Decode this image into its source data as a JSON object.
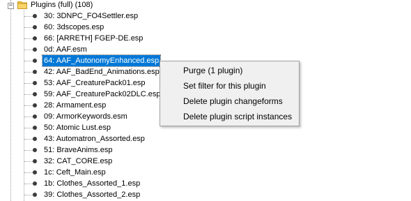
{
  "tree": {
    "root_label": "Plugins (full) (108)",
    "root_expander": "−",
    "items": [
      {
        "label": "30: 3DNPC_FO4Settler.esp"
      },
      {
        "label": "60: 3dscopes.esp"
      },
      {
        "label": "66: [ARRETH] FGEP-DE.esp"
      },
      {
        "label": "0d: AAF.esm"
      },
      {
        "label": "64: AAF_AutonomyEnhanced.esp"
      },
      {
        "label": "42: AAF_BadEnd_Animations.esp"
      },
      {
        "label": "53: AAF_CreaturePack01.esp"
      },
      {
        "label": "59: AAF_CreaturePack02DLC.esp"
      },
      {
        "label": "28: Armament.esp"
      },
      {
        "label": "09: ArmorKeywords.esm"
      },
      {
        "label": "50: Atomic Lust.esp"
      },
      {
        "label": "43: Automatron_Assorted.esp"
      },
      {
        "label": "51: BraveAnims.esp"
      },
      {
        "label": "32: CAT_CORE.esp"
      },
      {
        "label": "1c: Ceft_Main.esp"
      },
      {
        "label": "1b: Clothes_Assorted_1.esp"
      },
      {
        "label": "39: Clothes_Assorted_2.esp"
      }
    ]
  },
  "context_menu": {
    "items": [
      {
        "label": "Purge (1 plugin)"
      },
      {
        "label": "Set filter for this plugin"
      },
      {
        "label": "Delete plugin changeforms"
      },
      {
        "label": "Delete plugin script instances"
      }
    ]
  },
  "colors": {
    "selection": "#0078d7",
    "folder": "#f5c542",
    "menu_background": "#f0f0f0"
  }
}
